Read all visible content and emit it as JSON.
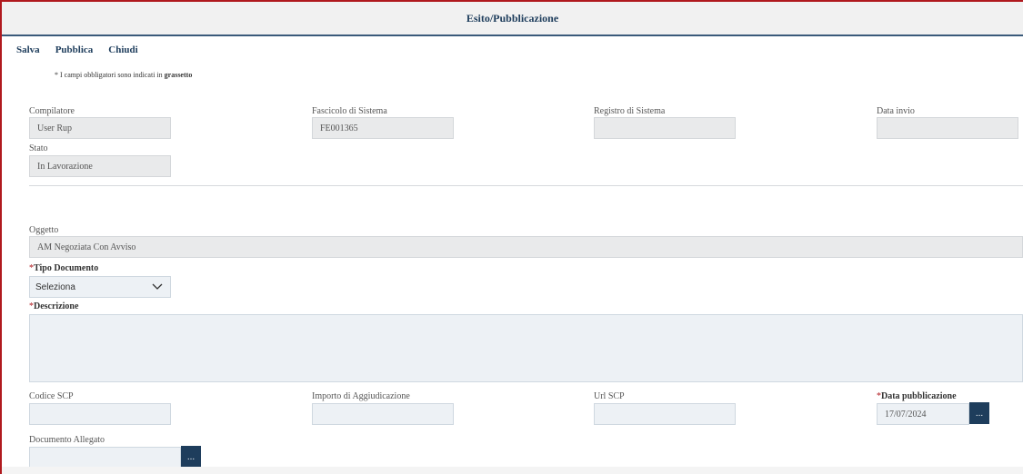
{
  "title": "Esito/Pubblicazione",
  "toolbar": {
    "save": "Salva",
    "publish": "Pubblica",
    "close": "Chiudi"
  },
  "note": {
    "text": "* I campi obbligatori sono indicati in",
    "bold": "grassetto"
  },
  "header_fields": {
    "compilatore": {
      "label": "Compilatore",
      "value": "User Rup"
    },
    "fascicolo": {
      "label": "Fascicolo di Sistema",
      "value": "FE001365"
    },
    "registro": {
      "label": "Registro di Sistema",
      "value": ""
    },
    "data_invio": {
      "label": "Data invio",
      "value": ""
    },
    "stato": {
      "label": "Stato",
      "value": "In Lavorazione"
    }
  },
  "oggetto": {
    "label": "Oggetto",
    "value": "AM Negoziata Con Avviso"
  },
  "tipo_documento": {
    "star": "*",
    "label": "Tipo Documento",
    "selected": "Seleziona"
  },
  "descrizione": {
    "star": "*",
    "label": "Descrizione",
    "value": ""
  },
  "codice_scp": {
    "label": "Codice SCP",
    "value": ""
  },
  "importo": {
    "label": "Importo di Aggiudicazione",
    "value": ""
  },
  "url_scp": {
    "label": "Url SCP",
    "value": ""
  },
  "data_pubblicazione": {
    "star": "*",
    "label": "Data pubblicazione",
    "value": "17/07/2024"
  },
  "documento_allegato": {
    "label": "Documento Allegato",
    "value": ""
  },
  "dots_button": "..."
}
